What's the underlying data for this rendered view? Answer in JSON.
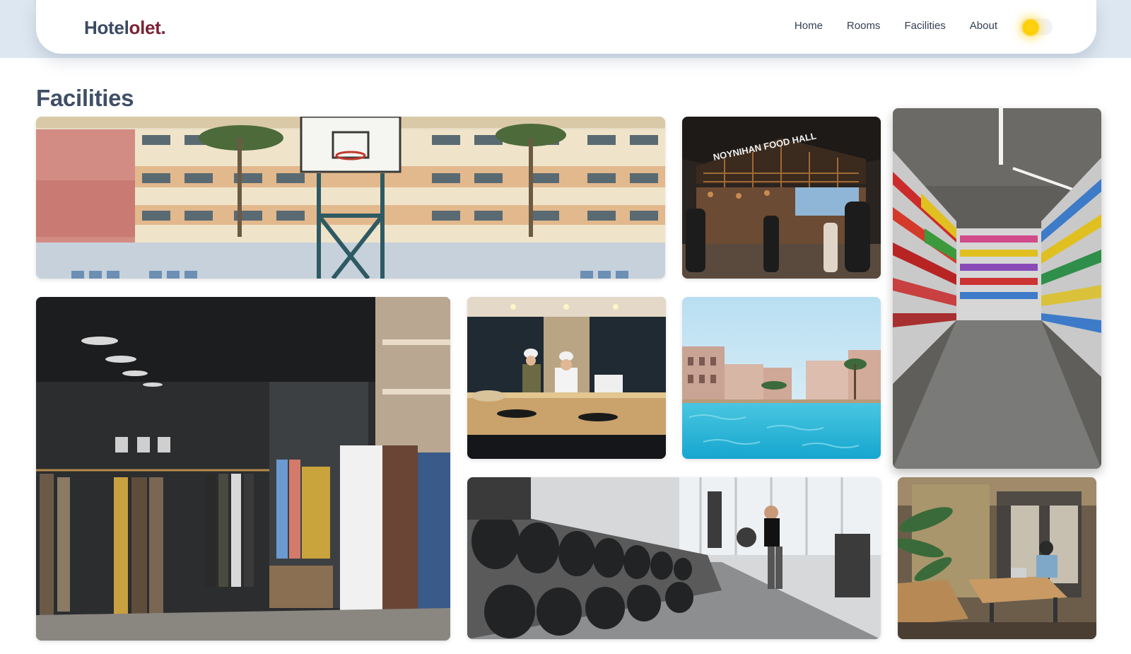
{
  "brand": {
    "part1": "Hotel",
    "part2": "olet",
    "dot": "."
  },
  "nav": {
    "links": [
      "Home",
      "Rooms",
      "Facilities",
      "About"
    ],
    "theme_toggle_icon": "sun-icon"
  },
  "page": {
    "title": "Facilities"
  },
  "colors": {
    "brand_dark": "#3b4a63",
    "brand_accent": "#7a2434",
    "sun": "#ffd21a",
    "header_band": "#dde7f1"
  },
  "gallery": [
    {
      "subject": "basketball-court"
    },
    {
      "subject": "food-hall",
      "sign_text": "NOYNIHAN FOOD HALL"
    },
    {
      "subject": "supermarket"
    },
    {
      "subject": "clothing-store"
    },
    {
      "subject": "sushi-bar"
    },
    {
      "subject": "swimming-pool"
    },
    {
      "subject": "gym"
    },
    {
      "subject": "coworking-space"
    }
  ]
}
